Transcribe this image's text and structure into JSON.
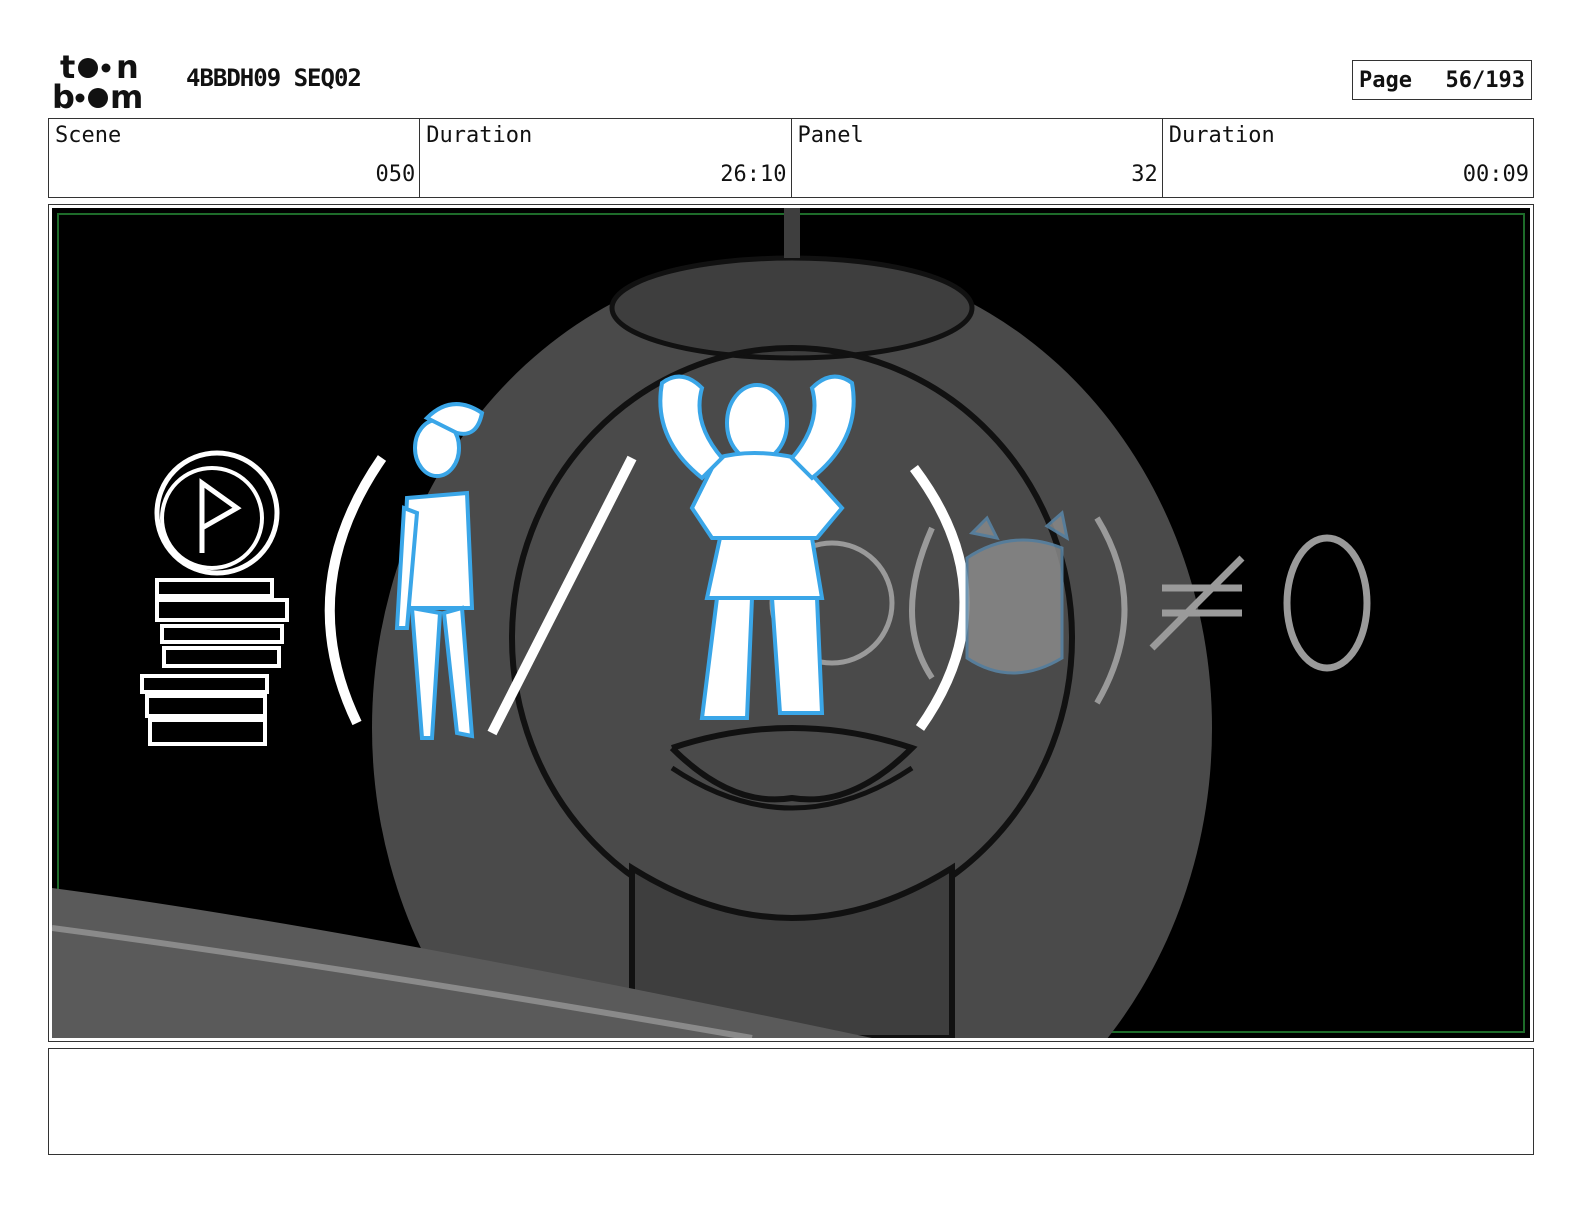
{
  "header": {
    "logo_text": "toon boom",
    "project": "4BBDH09 SEQ02",
    "page_label": "Page",
    "page_value": "56/193"
  },
  "info": {
    "scene_label": "Scene",
    "scene_value": "050",
    "scene_duration_label": "Duration",
    "scene_duration_value": "26:10",
    "panel_label": "Panel",
    "panel_value": "32",
    "panel_duration_label": "Duration",
    "panel_duration_value": "00:09"
  },
  "artwork": {
    "description_icon": "storyboard-sketch",
    "line_color_primary": "#ffffff",
    "line_color_accent": "#3aa6e8",
    "background_color": "#000000",
    "silhouette_color": "#4a4a4a",
    "border_color": "#1e6b2a"
  },
  "notes": {
    "text": ""
  }
}
